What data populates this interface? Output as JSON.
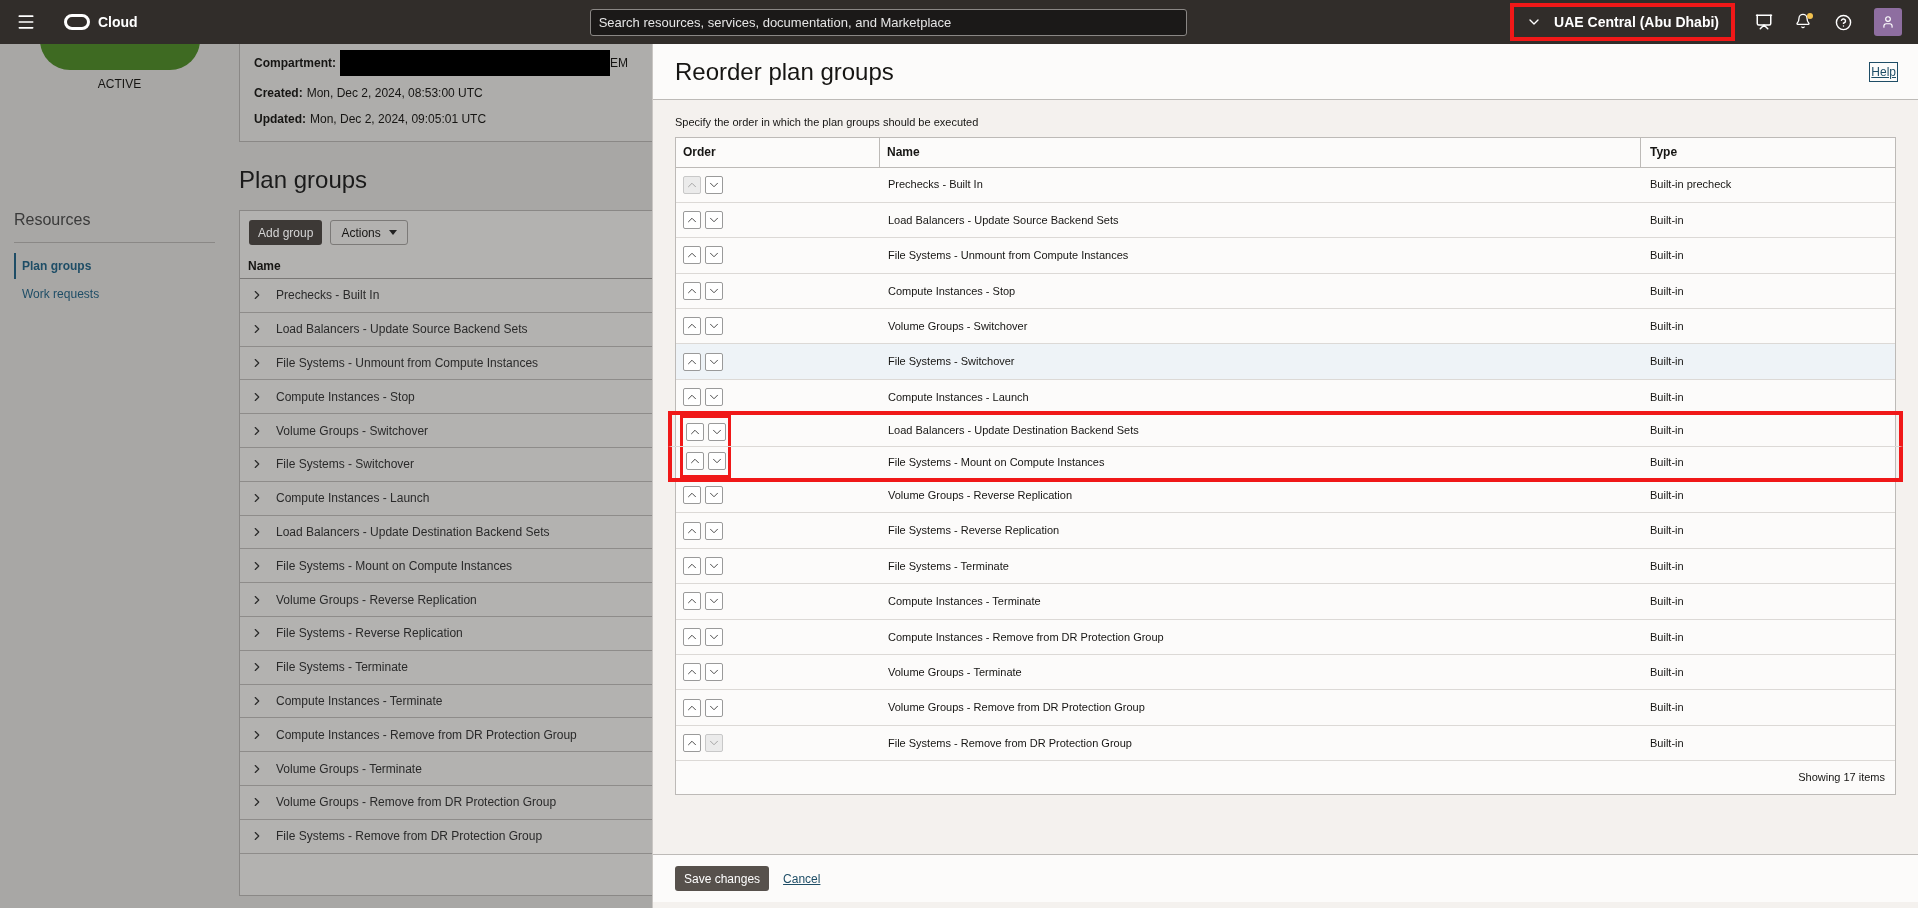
{
  "top_bar": {
    "brand": "Cloud",
    "search": {
      "placeholder": "Search resources, services, documentation, and Marketplace"
    },
    "region": {
      "label": "UAE Central (Abu Dhabi)",
      "highlighted": true
    },
    "notification_dot": true
  },
  "background_page": {
    "status": "ACTIVE",
    "details": [
      {
        "label": "Compartment:",
        "value": "EM",
        "redacted": true
      },
      {
        "label": "Created:",
        "value": "Mon, Dec 2, 2024, 08:53:00 UTC"
      },
      {
        "label": "Updated:",
        "value": "Mon, Dec 2, 2024, 09:05:01 UTC"
      }
    ],
    "resources": {
      "title": "Resources",
      "items": [
        {
          "label": "Plan groups",
          "selected": true
        },
        {
          "label": "Work requests",
          "selected": false
        }
      ]
    },
    "plan_groups": {
      "title": "Plan groups",
      "add_button": "Add group",
      "actions_button": "Actions",
      "column": "Name",
      "rows": [
        "Prechecks - Built In",
        "Load Balancers - Update Source Backend Sets",
        "File Systems - Unmount from Compute Instances",
        "Compute Instances - Stop",
        "Volume Groups - Switchover",
        "File Systems - Switchover",
        "Compute Instances - Launch",
        "Load Balancers - Update Destination Backend Sets",
        "File Systems - Mount on Compute Instances",
        "Volume Groups - Reverse Replication",
        "File Systems - Reverse Replication",
        "File Systems - Terminate",
        "Compute Instances - Terminate",
        "Compute Instances - Remove from DR Protection Group",
        "Volume Groups - Terminate",
        "Volume Groups - Remove from DR Protection Group",
        "File Systems - Remove from DR Protection Group"
      ]
    }
  },
  "dialog": {
    "title": "Reorder plan groups",
    "help": "Help",
    "description": "Specify the order in which the plan groups should be executed",
    "columns": [
      "Order",
      "Name",
      "Type"
    ],
    "rows": [
      {
        "name": "Prechecks - Built In",
        "type": "Built-in precheck",
        "up_disabled": true,
        "down_disabled": false,
        "hovered": false,
        "highlighted": false
      },
      {
        "name": "Load Balancers - Update Source Backend Sets",
        "type": "Built-in",
        "up_disabled": false,
        "down_disabled": false,
        "hovered": false,
        "highlighted": false
      },
      {
        "name": "File Systems - Unmount from Compute Instances",
        "type": "Built-in",
        "up_disabled": false,
        "down_disabled": false,
        "hovered": false,
        "highlighted": false
      },
      {
        "name": "Compute Instances - Stop",
        "type": "Built-in",
        "up_disabled": false,
        "down_disabled": false,
        "hovered": false,
        "highlighted": false
      },
      {
        "name": "Volume Groups - Switchover",
        "type": "Built-in",
        "up_disabled": false,
        "down_disabled": false,
        "hovered": false,
        "highlighted": false
      },
      {
        "name": "File Systems - Switchover",
        "type": "Built-in",
        "up_disabled": false,
        "down_disabled": false,
        "hovered": true,
        "highlighted": false
      },
      {
        "name": "Compute Instances - Launch",
        "type": "Built-in",
        "up_disabled": false,
        "down_disabled": false,
        "hovered": false,
        "highlighted": false
      },
      {
        "name": "Load Balancers - Update Destination Backend Sets",
        "type": "Built-in",
        "up_disabled": false,
        "down_disabled": false,
        "hovered": false,
        "highlighted": true
      },
      {
        "name": "File Systems - Mount on Compute Instances",
        "type": "Built-in",
        "up_disabled": false,
        "down_disabled": false,
        "hovered": false,
        "highlighted": true
      },
      {
        "name": "Volume Groups - Reverse Replication",
        "type": "Built-in",
        "up_disabled": false,
        "down_disabled": false,
        "hovered": false,
        "highlighted": false
      },
      {
        "name": "File Systems - Reverse Replication",
        "type": "Built-in",
        "up_disabled": false,
        "down_disabled": false,
        "hovered": false,
        "highlighted": false
      },
      {
        "name": "File Systems - Terminate",
        "type": "Built-in",
        "up_disabled": false,
        "down_disabled": false,
        "hovered": false,
        "highlighted": false
      },
      {
        "name": "Compute Instances - Terminate",
        "type": "Built-in",
        "up_disabled": false,
        "down_disabled": false,
        "hovered": false,
        "highlighted": false
      },
      {
        "name": "Compute Instances - Remove from DR Protection Group",
        "type": "Built-in",
        "up_disabled": false,
        "down_disabled": false,
        "hovered": false,
        "highlighted": false
      },
      {
        "name": "Volume Groups - Terminate",
        "type": "Built-in",
        "up_disabled": false,
        "down_disabled": false,
        "hovered": false,
        "highlighted": false
      },
      {
        "name": "Volume Groups - Remove from DR Protection Group",
        "type": "Built-in",
        "up_disabled": false,
        "down_disabled": false,
        "hovered": false,
        "highlighted": false
      },
      {
        "name": "File Systems - Remove from DR Protection Group",
        "type": "Built-in",
        "up_disabled": false,
        "down_disabled": true,
        "hovered": false,
        "highlighted": false
      }
    ],
    "count": "Showing 17 items",
    "save_button": "Save changes",
    "cancel_link": "Cancel"
  }
}
